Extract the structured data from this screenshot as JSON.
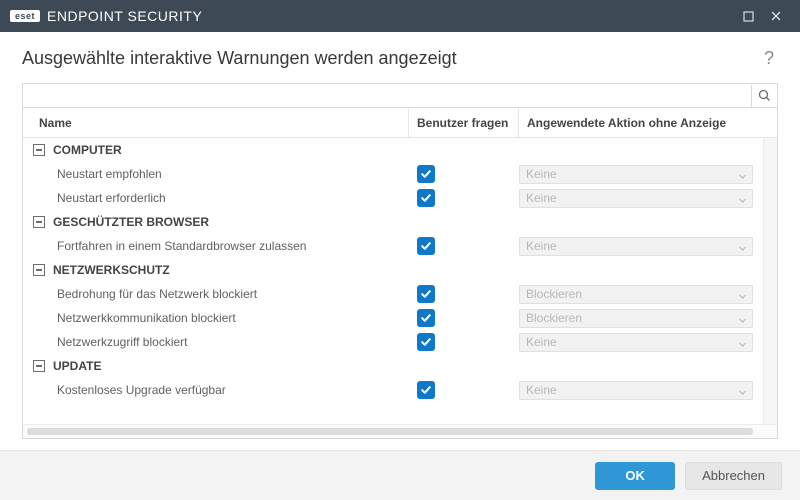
{
  "titlebar": {
    "product": "ENDPOINT SECURITY",
    "brand": "eset"
  },
  "header": {
    "title": "Ausgewählte interaktive Warnungen werden angezeigt"
  },
  "columns": {
    "name": "Name",
    "ask": "Benutzer fragen",
    "action": "Angewendete Aktion ohne Anzeige"
  },
  "groups": [
    {
      "label": "COMPUTER",
      "items": [
        {
          "label": "Neustart empfohlen",
          "ask": true,
          "action": "Keine"
        },
        {
          "label": "Neustart erforderlich",
          "ask": true,
          "action": "Keine"
        }
      ]
    },
    {
      "label": "GESCHÜTZTER BROWSER",
      "items": [
        {
          "label": "Fortfahren in einem Standardbrowser zulassen",
          "ask": true,
          "action": "Keine"
        }
      ]
    },
    {
      "label": "NETZWERKSCHUTZ",
      "items": [
        {
          "label": "Bedrohung für das Netzwerk blockiert",
          "ask": true,
          "action": "Blockieren"
        },
        {
          "label": "Netzwerkkommunikation blockiert",
          "ask": true,
          "action": "Blockieren"
        },
        {
          "label": "Netzwerkzugriff blockiert",
          "ask": true,
          "action": "Keine"
        }
      ]
    },
    {
      "label": "UPDATE",
      "items": [
        {
          "label": "Kostenloses Upgrade verfügbar",
          "ask": true,
          "action": "Keine"
        }
      ]
    }
  ],
  "footer": {
    "ok": "OK",
    "cancel": "Abbrechen"
  }
}
